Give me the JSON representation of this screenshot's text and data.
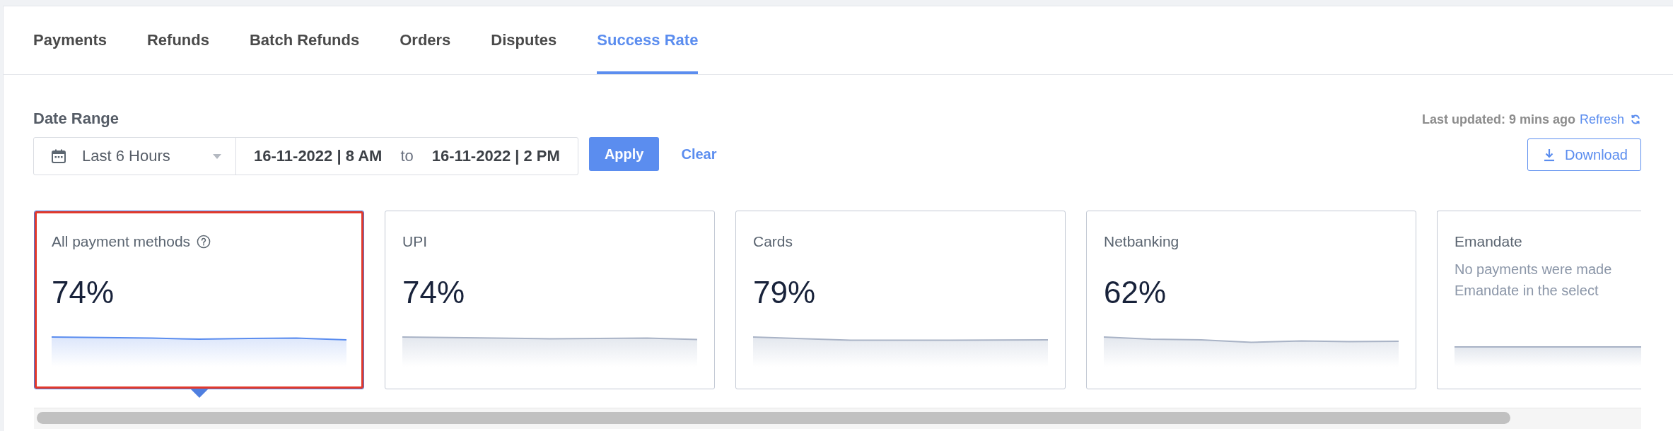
{
  "tabs": [
    {
      "label": "Payments",
      "selected": false
    },
    {
      "label": "Refunds",
      "selected": false
    },
    {
      "label": "Batch Refunds",
      "selected": false
    },
    {
      "label": "Orders",
      "selected": false
    },
    {
      "label": "Disputes",
      "selected": false
    },
    {
      "label": "Success Rate",
      "selected": true
    }
  ],
  "date_filter": {
    "label": "Date Range",
    "preset": "Last 6 Hours",
    "start": "16-11-2022 | 8 AM",
    "separator": "to",
    "end": "16-11-2022 | 2 PM",
    "apply_button": "Apply",
    "clear_button": "Clear"
  },
  "update_status": {
    "text": "Last updated: 9 mins ago",
    "refresh_link": "Refresh"
  },
  "download_button": "Download",
  "cards": [
    {
      "kind": "rate",
      "title": "All payment methods",
      "help_icon": true,
      "value": "74%",
      "selected": true,
      "highlighted": true
    },
    {
      "kind": "rate",
      "title": "UPI",
      "help_icon": false,
      "value": "74%",
      "selected": false,
      "highlighted": false
    },
    {
      "kind": "rate",
      "title": "Cards",
      "help_icon": false,
      "value": "79%",
      "selected": false,
      "highlighted": false
    },
    {
      "kind": "rate",
      "title": "Netbanking",
      "help_icon": false,
      "value": "62%",
      "selected": false,
      "highlighted": false
    },
    {
      "kind": "empty",
      "title": "Emandate",
      "help_icon": false,
      "message_lines": [
        "No payments were made",
        "Emandate in the select"
      ],
      "selected": false,
      "highlighted": false
    }
  ]
}
